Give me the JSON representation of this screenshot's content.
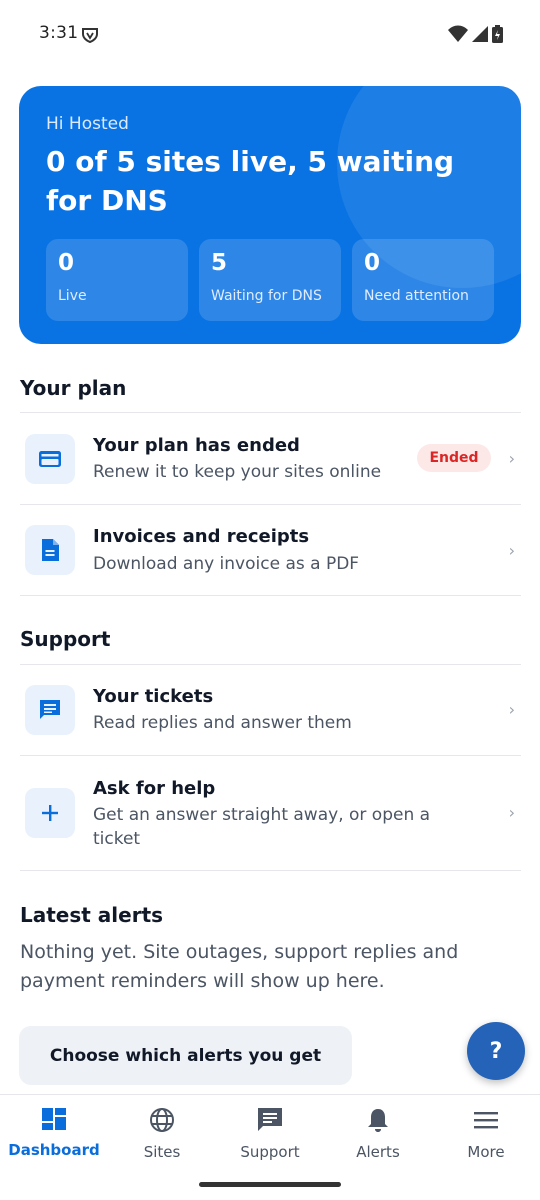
{
  "status_bar": {
    "time": "3:31"
  },
  "hero": {
    "greeting": "Hi Hosted",
    "title": "0 of 5 sites live, 5 waiting for DNS",
    "stats": [
      {
        "value": "0",
        "label": "Live"
      },
      {
        "value": "5",
        "label": "Waiting for DNS"
      },
      {
        "value": "0",
        "label": "Need attention"
      }
    ]
  },
  "plan": {
    "title": "Your plan",
    "items": [
      {
        "title": "Your plan has ended",
        "subtitle": "Renew it to keep your sites online",
        "badge": "Ended",
        "icon": "credit-card-icon"
      },
      {
        "title": "Invoices and receipts",
        "subtitle": "Download any invoice as a PDF",
        "icon": "document-icon"
      }
    ]
  },
  "support": {
    "title": "Support",
    "items": [
      {
        "title": "Your tickets",
        "subtitle": "Read replies and answer them",
        "icon": "chat-icon"
      },
      {
        "title": "Ask for help",
        "subtitle": "Get an answer straight away, or open a ticket",
        "icon": "plus-icon"
      }
    ]
  },
  "alerts": {
    "title": "Latest alerts",
    "empty_text": "Nothing yet. Site outages, support replies and payment reminders will show up here.",
    "button_label": "Choose which alerts you get"
  },
  "fab": {
    "label": "?"
  },
  "nav": {
    "items": [
      {
        "label": "Dashboard",
        "icon": "dashboard-icon",
        "active": true
      },
      {
        "label": "Sites",
        "icon": "globe-icon"
      },
      {
        "label": "Support",
        "icon": "chat-icon"
      },
      {
        "label": "Alerts",
        "icon": "bell-icon"
      },
      {
        "label": "More",
        "icon": "menu-icon"
      }
    ]
  },
  "colors": {
    "accent": "#0a73e3",
    "danger": "#dc2626",
    "icon_bg": "#e8f1fc"
  },
  "chevron": "›"
}
